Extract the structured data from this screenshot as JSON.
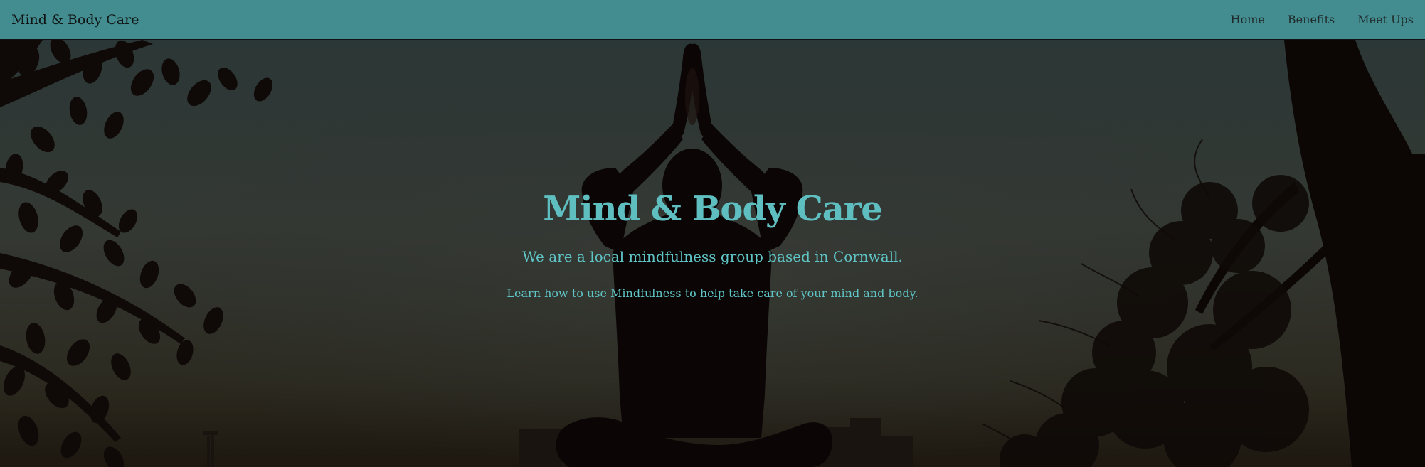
{
  "navbar": {
    "brand": "Mind & Body Care",
    "links": [
      {
        "label": "Home"
      },
      {
        "label": "Benefits"
      },
      {
        "label": "Meet Ups"
      }
    ]
  },
  "hero": {
    "title": "Mind & Body Care",
    "subtitle": "We are a local mindfulness group based in Cornwall.",
    "text": "Learn how to use Mindfulness to help take care of your mind and body."
  },
  "colors": {
    "navbar_bg": "#438c8f",
    "accent_text": "#5fc5c6",
    "hero_overlay": "#0d0908"
  }
}
